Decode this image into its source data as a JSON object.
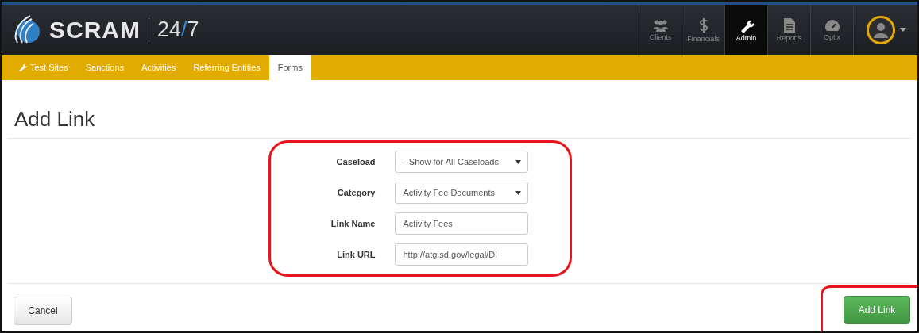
{
  "header": {
    "brand": "SCRAM",
    "product_prefix": "24",
    "product_slash": "/",
    "product_suffix": "7",
    "nav": [
      {
        "label": "Clients",
        "kind": "people",
        "selected": false
      },
      {
        "label": "Financials",
        "kind": "dollar",
        "selected": false
      },
      {
        "label": "Admin",
        "kind": "wrench",
        "selected": true
      },
      {
        "label": "Reports",
        "kind": "document",
        "selected": false
      },
      {
        "label": "Optix",
        "kind": "gauge",
        "selected": false
      }
    ]
  },
  "tabs": [
    {
      "label": "Test Sites",
      "kind": "wrench",
      "selected": false
    },
    {
      "label": "Sanctions",
      "selected": false
    },
    {
      "label": "Activities",
      "selected": false
    },
    {
      "label": "Referring Entities",
      "selected": false
    },
    {
      "label": "Forms",
      "selected": true
    }
  ],
  "page_title": "Add Link",
  "fields": [
    {
      "label": "Caseload",
      "kind": "select",
      "value": "--Show for All Caseloads-"
    },
    {
      "label": "Category",
      "kind": "select",
      "value": "Activity Fee Documents"
    },
    {
      "label": "Link Name",
      "kind": "text",
      "value": "Activity Fees"
    },
    {
      "label": "Link URL",
      "kind": "text",
      "value": "http://atg.sd.gov/legal/DI"
    }
  ],
  "buttons": {
    "cancel": "Cancel",
    "submit": "Add Link"
  }
}
